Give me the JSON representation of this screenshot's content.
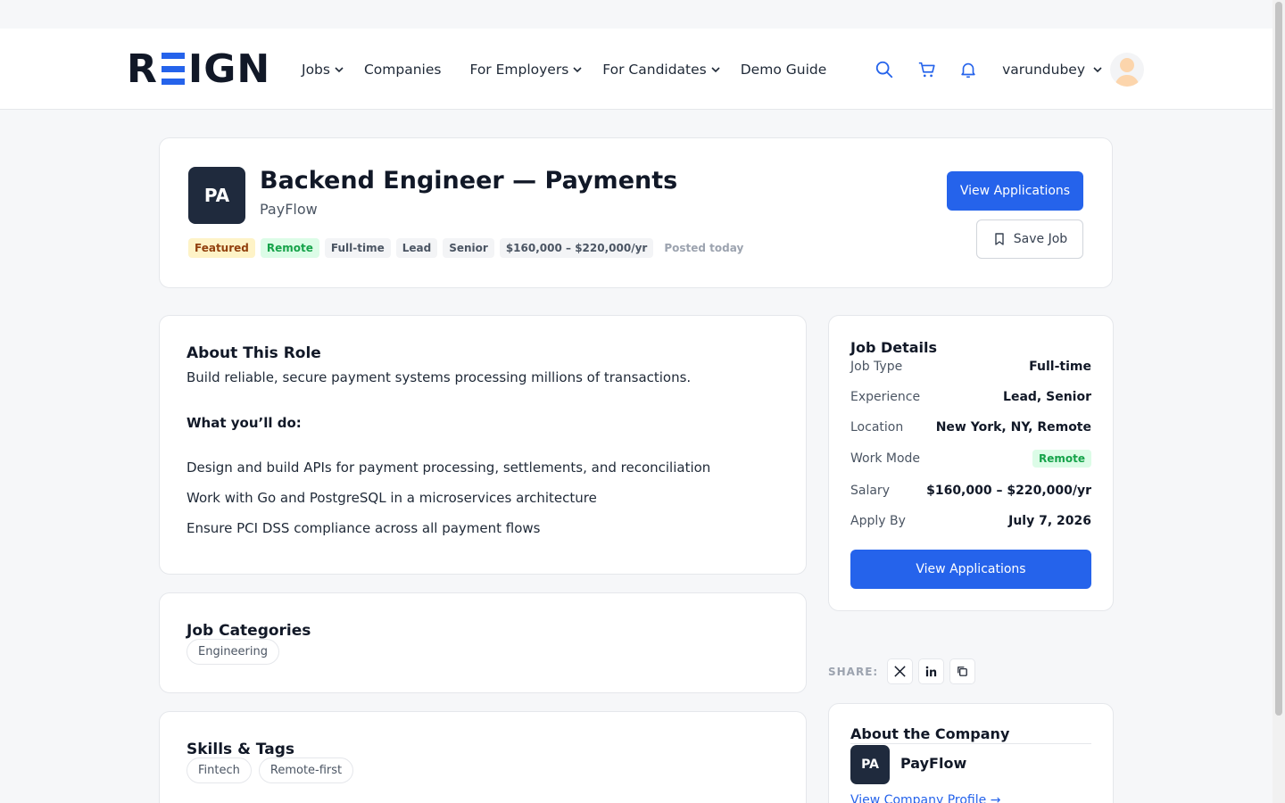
{
  "header": {
    "logo_text": "REIGN",
    "nav": [
      {
        "label": "Jobs",
        "has_dropdown": true
      },
      {
        "label": "Companies",
        "has_dropdown": false
      },
      {
        "label": "For Employers",
        "has_dropdown": true
      },
      {
        "label": "For Candidates",
        "has_dropdown": true
      },
      {
        "label": "Demo Guide",
        "has_dropdown": false
      }
    ],
    "username": "varundubey",
    "icons": [
      "search-icon",
      "cart-icon",
      "bell-icon",
      "chevron-down-icon"
    ]
  },
  "job": {
    "logo_initials": "PA",
    "title": "Backend Engineer — Payments",
    "company": "PayFlow",
    "tags": [
      {
        "label": "Featured",
        "variant": "featured"
      },
      {
        "label": "Remote",
        "variant": "remote"
      },
      {
        "label": "Full-time",
        "variant": "default"
      },
      {
        "label": "Lead",
        "variant": "default"
      },
      {
        "label": "Senior",
        "variant": "default"
      },
      {
        "label": "$160,000 – $220,000/yr",
        "variant": "default"
      }
    ],
    "posted": "Posted today",
    "view_applications_label": "View Applications",
    "save_job_label": "Save Job"
  },
  "about": {
    "title": "About This Role",
    "intro": "Build reliable, secure payment systems processing millions of transactions.",
    "subtitle": "What you’ll do:",
    "items": [
      "Design and build APIs for payment processing, settlements, and reconciliation",
      "Work with Go and PostgreSQL in a microservices architecture",
      "Ensure PCI DSS compliance across all payment flows"
    ]
  },
  "categories": {
    "title": "Job Categories",
    "items": [
      "Engineering"
    ]
  },
  "skills": {
    "title": "Skills & Tags",
    "items": [
      "Fintech",
      "Remote-first"
    ]
  },
  "details": {
    "title": "Job Details",
    "rows": [
      {
        "label": "Job Type",
        "value": "Full-time"
      },
      {
        "label": "Experience",
        "value": "Lead, Senior"
      },
      {
        "label": "Location",
        "value": "New York, NY, Remote"
      },
      {
        "label": "Work Mode",
        "value": "Remote"
      },
      {
        "label": "Salary",
        "value": "$160,000 – $220,000/yr"
      },
      {
        "label": "Apply By",
        "value": "July 7, 2026"
      }
    ],
    "button_label": "View Applications"
  },
  "share": {
    "label": "SHARE:",
    "icons": [
      "x-twitter-icon",
      "linkedin-icon",
      "copy-link-icon"
    ]
  },
  "company": {
    "title": "About the Company",
    "logo_initials": "PA",
    "name": "PayFlow",
    "link_label": "View Company Profile →"
  },
  "colors": {
    "primary": "#2563eb",
    "logo_bg": "#1f2a3d",
    "featured_bg": "#fef3c7",
    "remote_bg": "#dcfce7",
    "remote_text": "#16a34a"
  }
}
